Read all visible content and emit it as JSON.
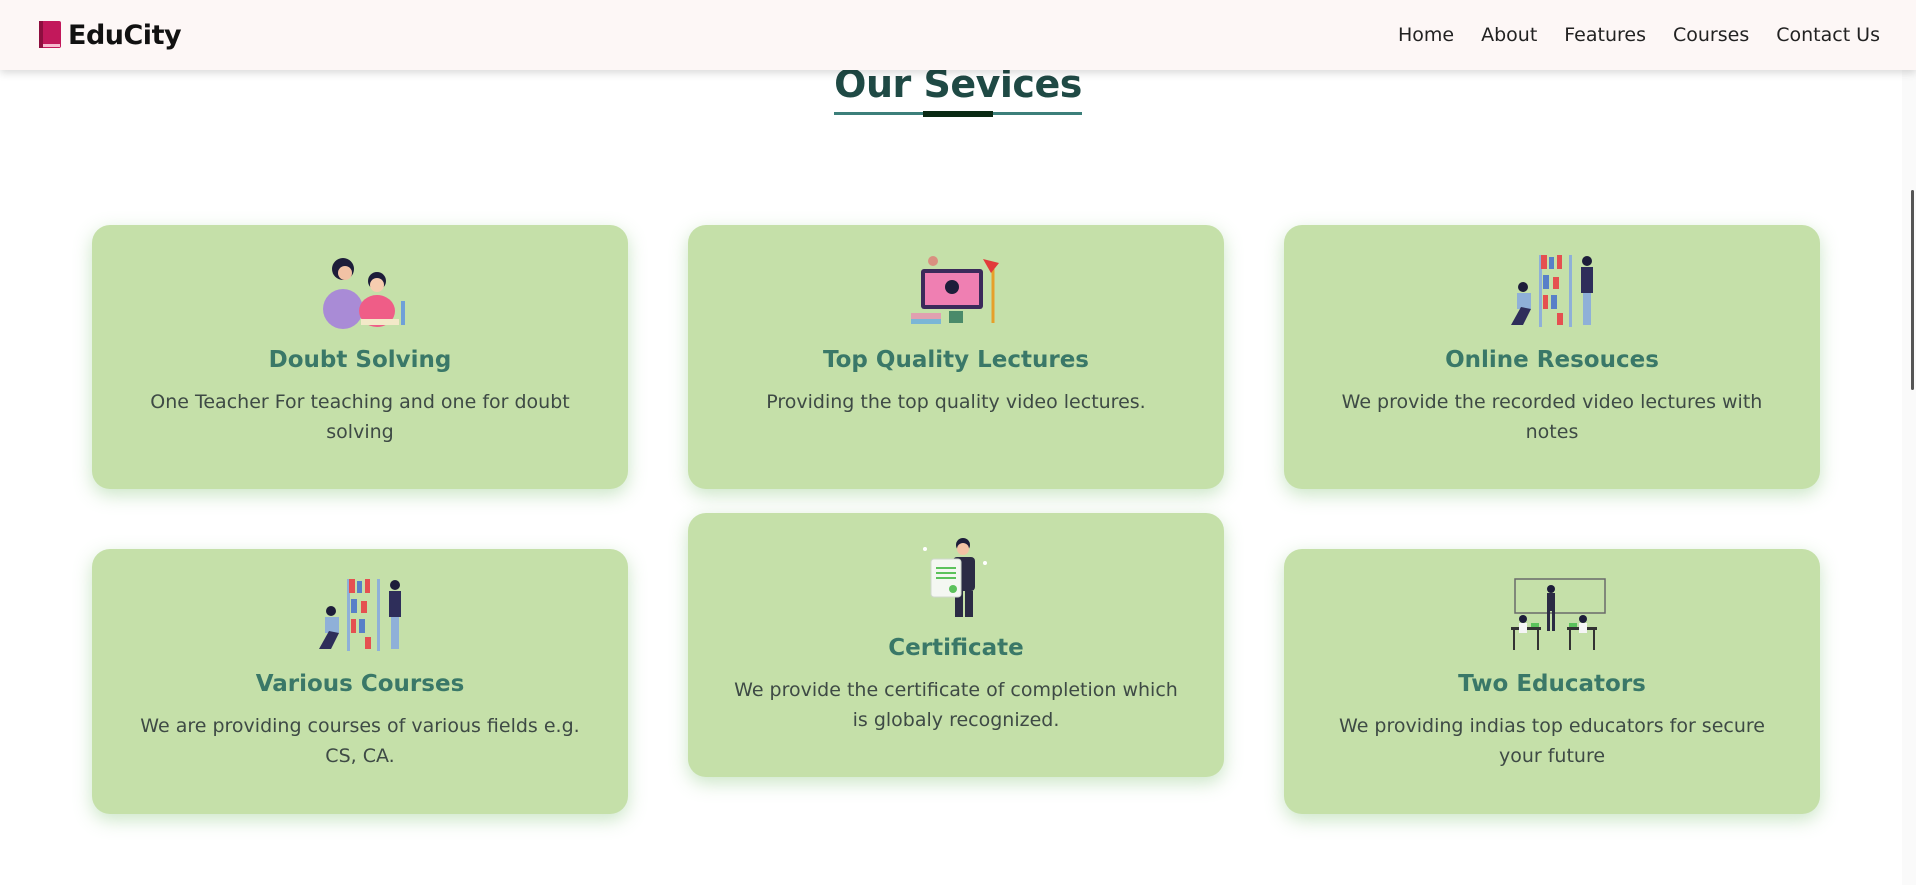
{
  "navbar": {
    "brand": "EduCity",
    "brand_icon": "book-icon",
    "links": [
      "Home",
      "About",
      "Features",
      "Courses",
      "Contact Us"
    ]
  },
  "section": {
    "title": "Our Sevices"
  },
  "colors": {
    "card_bg": "#c5e0a9",
    "card_title": "#3a7868",
    "section_title": "#1f4a45",
    "brand_book": "#c2185b"
  },
  "services": [
    {
      "icon": "teacher-student-illustration",
      "title": "Doubt Solving",
      "text": "One Teacher For teaching and one for doubt solving"
    },
    {
      "icon": "video-lecture-illustration",
      "title": "Top Quality Lectures",
      "text": "Providing the top quality video lectures."
    },
    {
      "icon": "bookshelf-reading-illustration",
      "title": "Online Resouces",
      "text": "We provide the recorded video lectures with notes"
    },
    {
      "icon": "bookshelf-courses-illustration",
      "title": "Various Courses",
      "text": "We are providing courses of various fields e.g. CS, CA."
    },
    {
      "icon": "certificate-illustration",
      "title": "Certificate",
      "text": "We provide the certificate of completion which is globaly recognized."
    },
    {
      "icon": "classroom-illustration",
      "title": "Two Educators",
      "text": "We providing indias top educators for secure your future"
    }
  ]
}
